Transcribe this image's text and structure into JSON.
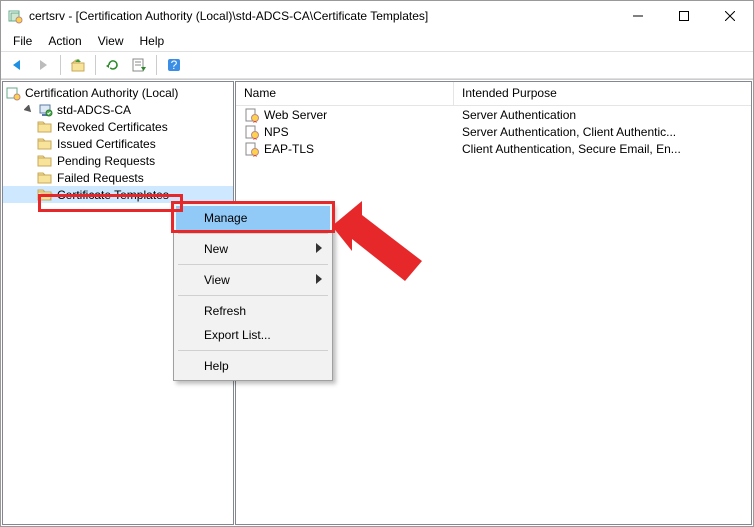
{
  "window": {
    "title": "certsrv - [Certification Authority (Local)\\std-ADCS-CA\\Certificate Templates]"
  },
  "menubar": {
    "file": "File",
    "action": "Action",
    "view": "View",
    "help": "Help"
  },
  "tree": {
    "root": "Certification Authority (Local)",
    "ca": "std-ADCS-CA",
    "nodes": {
      "revoked": "Revoked Certificates",
      "issued": "Issued Certificates",
      "pending": "Pending Requests",
      "failed": "Failed Requests",
      "templates": "Certificate Templates"
    }
  },
  "columns": {
    "name": "Name",
    "purpose": "Intended Purpose"
  },
  "rows": [
    {
      "name": "Web Server",
      "purpose": "Server Authentication"
    },
    {
      "name": "NPS",
      "purpose": "Server Authentication, Client Authentic..."
    },
    {
      "name": "EAP-TLS",
      "purpose": "Client Authentication, Secure Email, En..."
    }
  ],
  "context_menu": {
    "manage": "Manage",
    "new": "New",
    "view": "View",
    "refresh": "Refresh",
    "export": "Export List...",
    "help": "Help"
  }
}
